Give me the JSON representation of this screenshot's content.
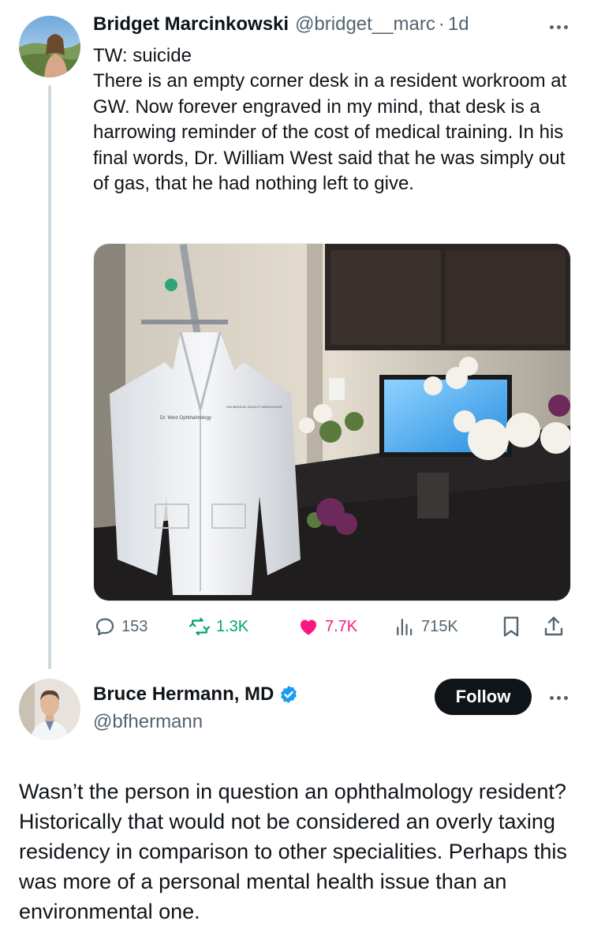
{
  "tweet": {
    "author_name": "Bridget Marcinkowski",
    "handle": "@bridget__marc",
    "separator": "·",
    "time": "1d",
    "content_warning": "TW: suicide",
    "text": "There is an empty corner desk in a resident workroom at GW. Now forever engraved in my mind, that desk is a harrowing reminder of the cost of medical training. In his final words, Dr. William West said that he was simply out of gas, that he had nothing left to give.",
    "photo": {
      "coat_tag": "Dr. West Ophthalmology",
      "coat_pocket_text": "GW MEDICAL FACULTY ASSOCIATES"
    },
    "stats": {
      "replies": "153",
      "reposts": "1.3K",
      "likes": "7.7K",
      "views": "715K"
    }
  },
  "reply": {
    "author_name": "Bruce Hermann, MD",
    "handle": "@bfhermann",
    "verified": true,
    "follow_label": "Follow",
    "text": "Wasn’t the person in question an ophthalmology resident? Historically that would not be considered an overly taxing residency in comparison to other specialities. Perhaps this was more of a personal mental health issue than an environmental one."
  },
  "colors": {
    "text": "#0f1419",
    "secondary": "#536471",
    "like": "#f91880",
    "repost": "#00a36c",
    "verified": "#1d9bf0",
    "thread_line": "#cfd9de"
  },
  "icons": [
    "reply-icon",
    "repost-icon",
    "like-icon",
    "views-icon",
    "bookmark-icon",
    "share-icon",
    "verified-badge-icon",
    "more-icon"
  ]
}
